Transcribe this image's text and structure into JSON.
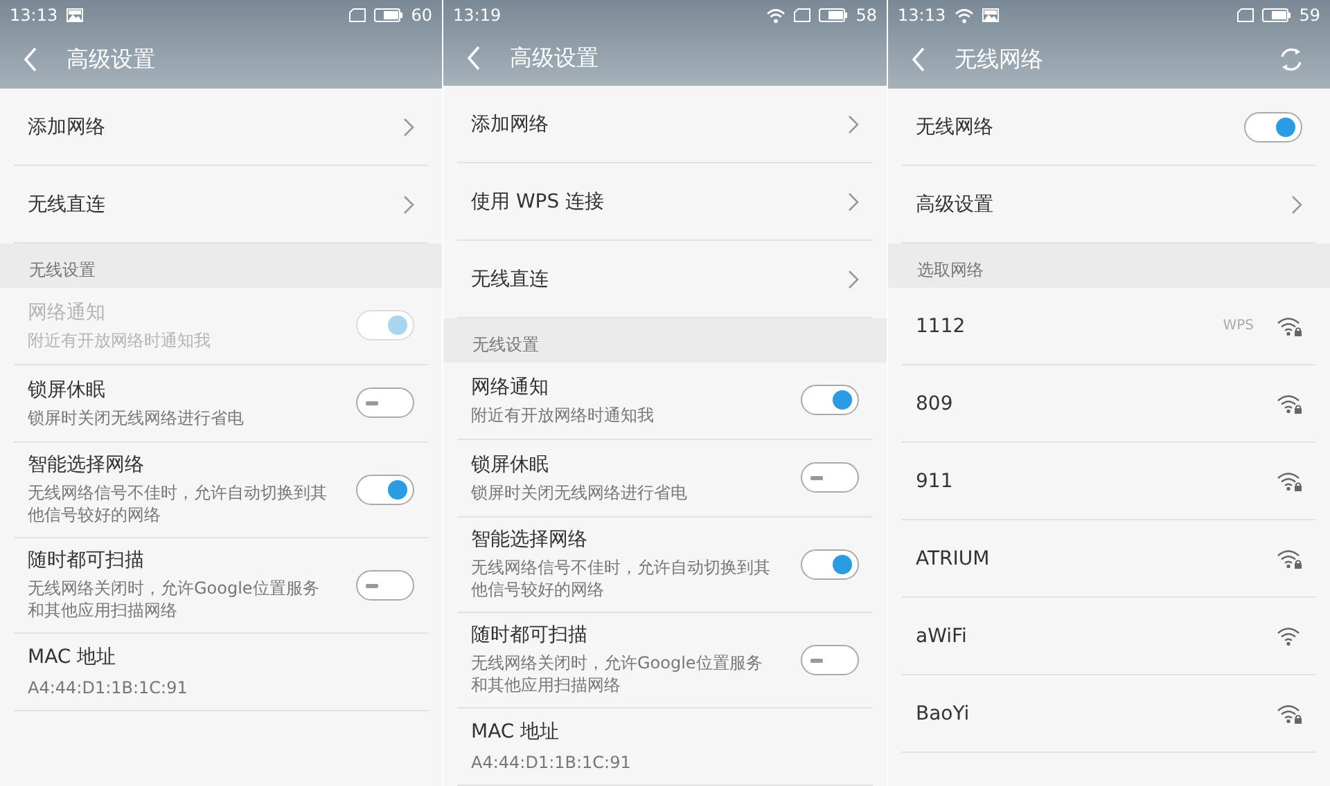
{
  "phones": [
    {
      "status": {
        "time": "13:13",
        "left_icons": [
          {
            "kind": "image"
          }
        ],
        "right_icons": [
          {
            "kind": "sim"
          },
          {
            "kind": "battery"
          }
        ],
        "battery": "60"
      },
      "title": "高级设置",
      "items": [
        {
          "kind": "link",
          "label": "添加网络"
        },
        {
          "kind": "link",
          "label": "无线直连"
        },
        {
          "kind": "section",
          "label": "无线设置"
        },
        {
          "kind": "toggle",
          "label": "网络通知",
          "summary": "附近有开放网络时通知我",
          "on": true,
          "disabled": true
        },
        {
          "kind": "toggle",
          "label": "锁屏休眠",
          "summary": "锁屏时关闭无线网络进行省电",
          "on": false,
          "disabled": false
        },
        {
          "kind": "toggle",
          "label": "智能选择网络",
          "summary": "无线网络信号不佳时，允许自动切换到其他信号较好的网络",
          "on": true,
          "disabled": false
        },
        {
          "kind": "toggle",
          "label": "随时都可扫描",
          "summary": "无线网络关闭时，允许Google位置服务和其他应用扫描网络",
          "on": false,
          "disabled": false
        },
        {
          "kind": "info",
          "label": "MAC 地址",
          "value": "A4:44:D1:1B:1C:91"
        }
      ]
    },
    {
      "status": {
        "time": "13:19",
        "right_icons": [
          {
            "kind": "wifi"
          },
          {
            "kind": "sim"
          },
          {
            "kind": "battery"
          }
        ],
        "battery": "58"
      },
      "title": "高级设置",
      "items": [
        {
          "kind": "link",
          "label": "添加网络"
        },
        {
          "kind": "link",
          "label": "使用 WPS 连接"
        },
        {
          "kind": "link",
          "label": "无线直连"
        },
        {
          "kind": "section",
          "label": "无线设置"
        },
        {
          "kind": "toggle",
          "label": "网络通知",
          "summary": "附近有开放网络时通知我",
          "on": true,
          "disabled": false
        },
        {
          "kind": "toggle",
          "label": "锁屏休眠",
          "summary": "锁屏时关闭无线网络进行省电",
          "on": false,
          "disabled": false
        },
        {
          "kind": "toggle",
          "label": "智能选择网络",
          "summary": "无线网络信号不佳时，允许自动切换到其他信号较好的网络",
          "on": true,
          "disabled": false
        },
        {
          "kind": "toggle",
          "label": "随时都可扫描",
          "summary": "无线网络关闭时，允许Google位置服务和其他应用扫描网络",
          "on": false,
          "disabled": false
        },
        {
          "kind": "info",
          "label": "MAC 地址",
          "value": "A4:44:D1:1B:1C:91"
        }
      ]
    },
    {
      "status": {
        "time": "13:13",
        "left_icons": [
          {
            "kind": "wifi"
          },
          {
            "kind": "image"
          }
        ],
        "right_icons": [
          {
            "kind": "sim"
          },
          {
            "kind": "battery"
          }
        ],
        "battery": "59"
      },
      "title": "无线网络",
      "refresh": true,
      "items": [
        {
          "kind": "toggle",
          "label": "无线网络",
          "on": true,
          "disabled": false
        },
        {
          "kind": "link",
          "label": "高级设置"
        },
        {
          "kind": "section",
          "label": "选取网络"
        },
        {
          "kind": "network",
          "label": "1112",
          "badge": "WPS",
          "locked": true
        },
        {
          "kind": "network",
          "label": "809",
          "locked": true
        },
        {
          "kind": "network",
          "label": "911",
          "locked": true
        },
        {
          "kind": "network",
          "label": "ATRIUM",
          "locked": true
        },
        {
          "kind": "network",
          "label": "aWiFi",
          "locked": false
        },
        {
          "kind": "network",
          "label": "BaoYi",
          "locked": true
        }
      ]
    }
  ]
}
